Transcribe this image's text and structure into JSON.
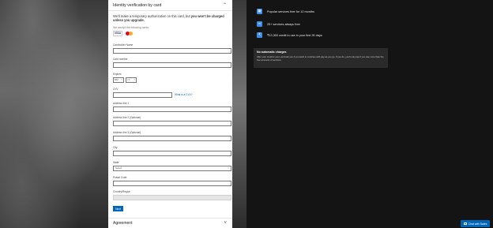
{
  "form": {
    "title": "Identity verification by card",
    "intro_normal": "We'll make a temporary authorization on this card, but ",
    "intro_bold": "you won't be charged unless you upgrade.",
    "accept_text": "We accept the following cards:",
    "cards": [
      "VISA",
      "Mastercard"
    ],
    "labels": {
      "cardholder": "Cardholder Name",
      "card_number": "Card number",
      "expires": "Expires",
      "cvv": "CVV",
      "address1": "Address line 1",
      "address2": "Address line 2 (Optional)",
      "address3": "Address line 3 (Optional)",
      "city": "City",
      "state": "State",
      "postal": "Postal Code",
      "country": "Country/Region"
    },
    "expiry_month": "MM",
    "expiry_year": "YY",
    "cvv_link": "What is a CVV?",
    "state_placeholder": "Select",
    "next_label": "Next"
  },
  "agreement": {
    "title": "Agreement"
  },
  "info": {
    "items": [
      {
        "icon": "calendar-icon",
        "text": "Popular services free for 12 months"
      },
      {
        "icon": "infinity-icon",
        "text": "25+ services always free"
      },
      {
        "icon": "credit-icon",
        "text": "₹13,300 credit to use in your first 30 days"
      }
    ],
    "no_charge_title": "No automatic charges",
    "no_charge_text": "After your credit is over, we'll ask you if you want to continue with pay as you go. If you do, you'll only pay if you use more than the free amounts of services."
  },
  "chat": {
    "label": "Chat with Sales"
  },
  "colors": {
    "accent": "#0067b8",
    "info_icon": "#3b8eea"
  }
}
